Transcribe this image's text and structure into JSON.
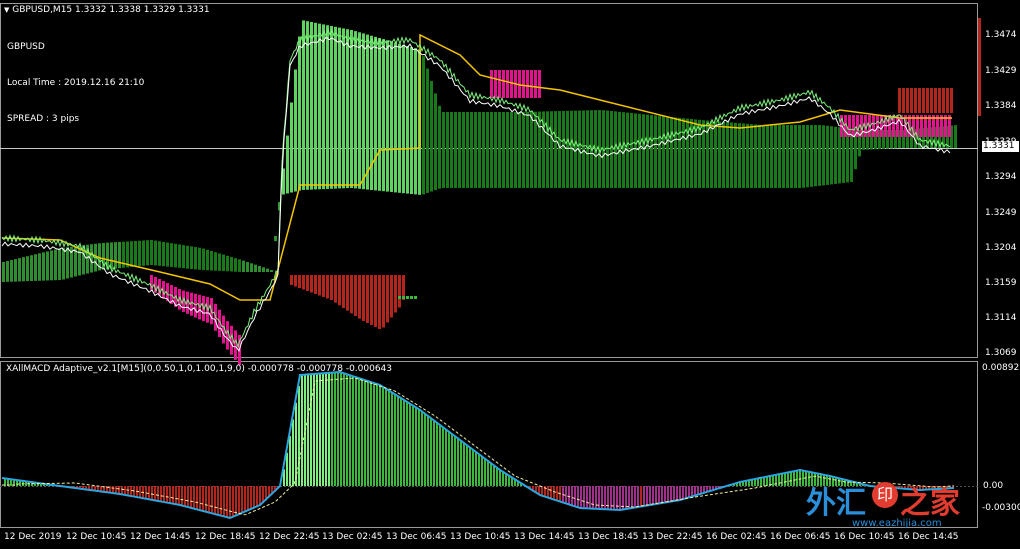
{
  "header": {
    "symbol_line": "GBPUSD,M15  1.3332 1.3338 1.3329 1.3331",
    "menu_icon": "triangle-down-icon"
  },
  "info_panel": {
    "symbol": "GBPUSD",
    "local_time": "Local Time : 2019.12.16 21:10",
    "spread": "SPREAD : 3 pips"
  },
  "price_axis": {
    "labels": [
      "1.3474",
      "1.3429",
      "1.3384",
      "1.3339",
      "1.3294",
      "1.3249",
      "1.3204",
      "1.3159",
      "1.3114",
      "1.3069"
    ],
    "current_price": "1.3331"
  },
  "indicator": {
    "title": "XAllMACD Adaptive_v2.1[M15](0,0.50,1,0,1.00,1,9,0) -0.000778 -0.000778 -0.000643",
    "axis_top": "0.008921",
    "axis_zero": "0.00",
    "axis_bottom": "-0.003007"
  },
  "time_axis": {
    "labels": [
      "12 Dec 2019",
      "12 Dec 10:45",
      "12 Dec 14:45",
      "12 Dec 18:45",
      "12 Dec 22:45",
      "13 Dec 02:45",
      "13 Dec 06:45",
      "13 Dec 10:45",
      "13 Dec 14:45",
      "13 Dec 18:45",
      "13 Dec 22:45",
      "16 Dec 02:45",
      "16 Dec 06:45",
      "16 Dec 10:45",
      "16 Dec 14:45"
    ]
  },
  "watermark": {
    "left_char": "外汇",
    "mid_char": "印",
    "right_chars": "之家",
    "url": "www.eazhijia.com"
  },
  "colors": {
    "up_green": "#3cb83c",
    "dark_green": "#1a7a1a",
    "bear_red": "#b3261e",
    "magenta": "#e0148c",
    "gold_line": "#f5c400",
    "macd_line": "#2aa6e0",
    "signal_line": "#f5f0a0"
  }
}
